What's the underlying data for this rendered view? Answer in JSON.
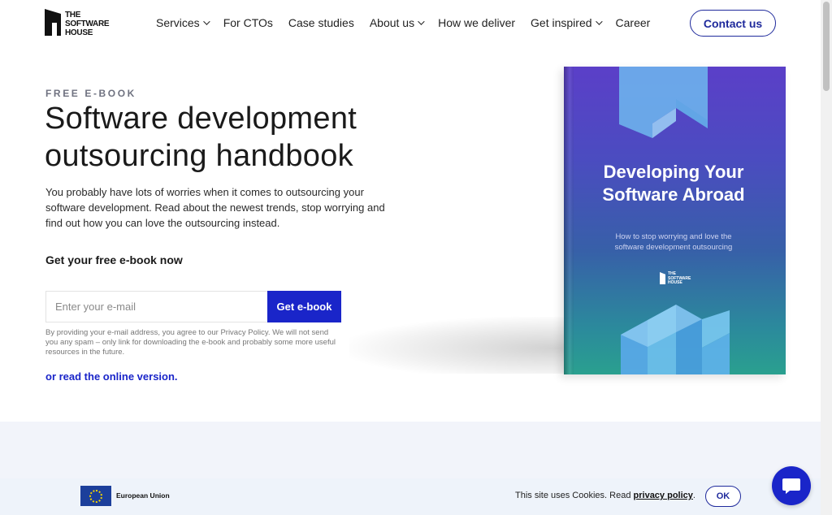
{
  "header": {
    "logo_text": [
      "THE",
      "SOFTWARE",
      "HOUSE"
    ],
    "nav": [
      {
        "label": "Services",
        "dropdown": true
      },
      {
        "label": "For CTOs",
        "dropdown": false
      },
      {
        "label": "Case studies",
        "dropdown": false
      },
      {
        "label": "About us",
        "dropdown": true
      },
      {
        "label": "How we deliver",
        "dropdown": false
      },
      {
        "label": "Get inspired",
        "dropdown": true
      },
      {
        "label": "Career",
        "dropdown": false
      }
    ],
    "contact_label": "Contact us"
  },
  "hero": {
    "eyebrow": "FREE E-BOOK",
    "title_line1": "Software development",
    "title_line2": "outsourcing handbook",
    "lead": "You probably have lots of worries when it comes to outsourcing your software development. Read about the newest trends, stop worrying and find out how you can love the outsourcing instead.",
    "form_title": "Get your free e-book now",
    "email_placeholder": "Enter your e-mail",
    "email_value": "",
    "submit_label": "Get e-book",
    "disclaimer": "By providing your e-mail address, you agree to our Privacy Policy. We will not send you any spam – only link for downloading the e-book and probably some more useful resources in the future.",
    "online_link": "or read the online version."
  },
  "book": {
    "title": "Developing Your Software Abroad",
    "subtitle": "How to stop worrying and love the software development outsourcing",
    "logo_text": [
      "THE",
      "SOFTWARE",
      "HOUSE"
    ]
  },
  "cookie": {
    "eu_label": "European Union",
    "text": "This site uses Cookies. Read",
    "link": "privacy policy",
    "period": ".",
    "ok_label": "OK"
  },
  "colors": {
    "accent": "#1a25c9",
    "outline": "#1f2a9c",
    "book_top": "#5b3fc8",
    "book_bottom": "#2aa08f"
  },
  "icons": {
    "chat": "chat-bubble-icon",
    "chevron": "chevron-down-icon",
    "eu_flag": "eu-flag-icon"
  }
}
